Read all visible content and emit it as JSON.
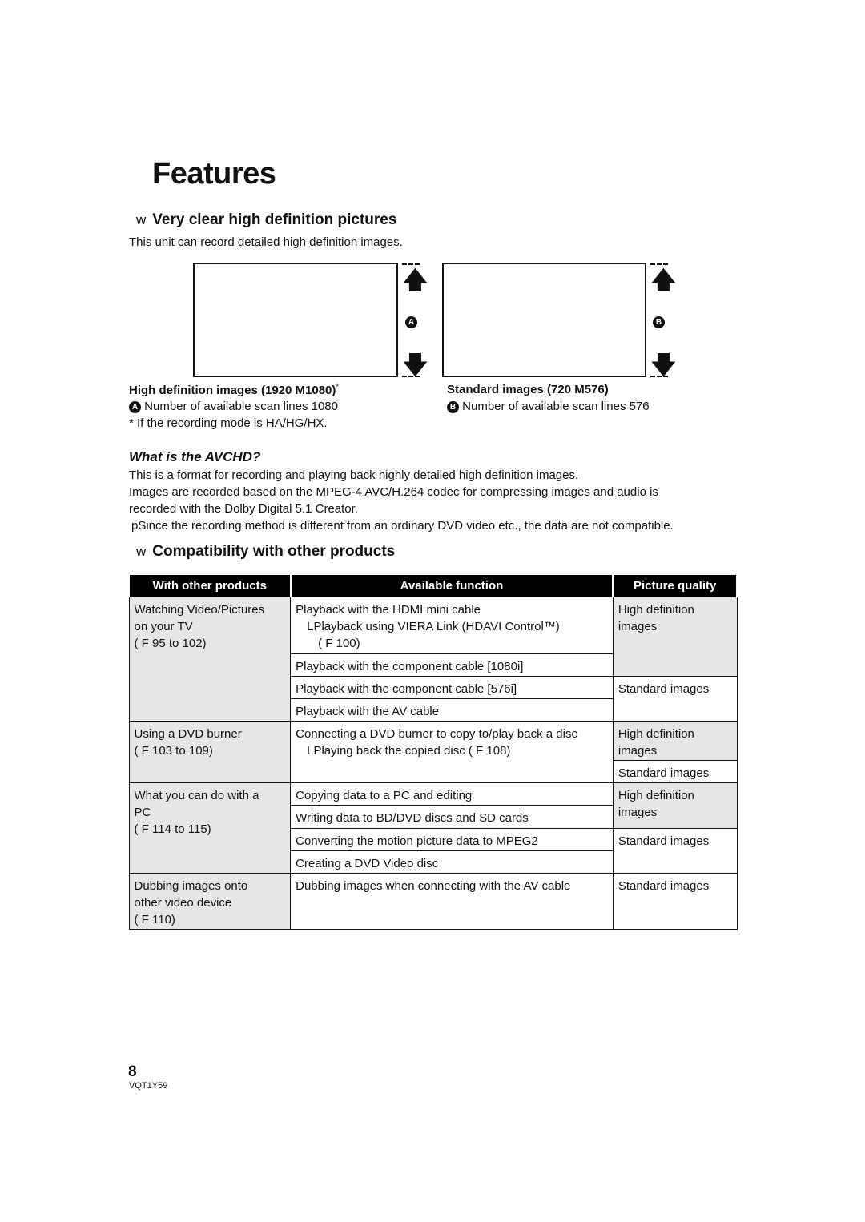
{
  "title": "Features",
  "section1": {
    "bullet": "w",
    "heading": "Very clear high definition pictures",
    "intro": "This unit can record detailed high definition images.",
    "hd": {
      "marker": "A",
      "caption": "High definition images (1920 M1080)",
      "asterisk": "*",
      "desc": "Number of available scan lines 1080",
      "note": "*  If the recording mode is HA/HG/HX."
    },
    "sd": {
      "marker": "B",
      "caption": "Standard images (720 M576)",
      "desc": "Number of available scan lines 576"
    }
  },
  "avchd": {
    "heading": "What is the AVCHD?",
    "p1": "This is a format for recording and playing back highly detailed high definition images.",
    "p2": "Images are recorded based on the MPEG-4 AVC/H.264 codec for compressing images and audio is",
    "p3": "recorded with the Dolby Digital 5.1 Creator.",
    "p4": "pSince the recording method is different from an ordinary DVD video etc., the data are not compatible."
  },
  "section2": {
    "bullet": "w",
    "heading": "Compatibility with other products"
  },
  "table": {
    "headers": [
      "With other products",
      "Available function",
      "Picture quality"
    ],
    "g1": {
      "product": [
        "Watching Video/Pictures",
        "on your TV",
        "( F 95 to 102)"
      ],
      "f1": [
        "Playback with the HDMI mini cable",
        "LPlayback using VIERA Link (HDAVI Control™)",
        "( F 100)"
      ],
      "f2": "Playback with the component cable [1080i]",
      "f3": "Playback with the component cable [576i]",
      "f4": "Playback with the AV cable",
      "q1": [
        "High definition",
        "images"
      ],
      "q2": "Standard images"
    },
    "g2": {
      "product": [
        "Using a DVD burner",
        "( F 103 to 109)"
      ],
      "f1": [
        "Connecting a DVD burner to copy to/play back a disc",
        "LPlaying back the copied disc ( F 108)"
      ],
      "q1": [
        "High definition",
        "images"
      ],
      "q2": "Standard images"
    },
    "g3": {
      "product": [
        "What you can do with a",
        "PC",
        "( F 114 to 115)"
      ],
      "f1": "Copying data to a PC and editing",
      "f2": "Writing data to BD/DVD discs and SD cards",
      "f3": "Converting the motion picture data to MPEG2",
      "f4": "Creating a DVD Video disc",
      "q1": [
        "High definition",
        "images"
      ],
      "q2": "Standard images"
    },
    "g4": {
      "product": [
        "Dubbing images onto",
        "other video device",
        "( F 110)"
      ],
      "f1": "Dubbing images when connecting with the AV cable",
      "q1": "Standard images"
    }
  },
  "footer": {
    "page": "8",
    "code": "VQT1Y59"
  }
}
